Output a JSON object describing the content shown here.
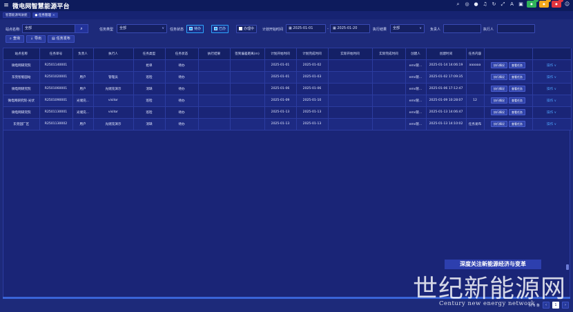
{
  "app": {
    "title": "微电网智慧能源平台"
  },
  "tabs": [
    {
      "label": "智慧能源驾驶舱"
    },
    {
      "label": "任务管理",
      "close": "×"
    }
  ],
  "filters": {
    "site_label": "站点名称:",
    "site_value": "全部",
    "task_type_label": "任务类型",
    "task_type_value": "全部",
    "task_status_label": "任务状态",
    "status_pending": "待办",
    "status_done": "已办",
    "status_doing": "办理中",
    "plan_start_label": "计划开始时间",
    "date_from": "2025-01-01",
    "date_sep": "-",
    "date_to": "2025-01-20",
    "exec_result_label": "执行结果",
    "exec_result_value": "全部",
    "owner_label": "负责人",
    "executor_label": "执行人"
  },
  "actions": {
    "query": "查询",
    "export": "导出",
    "publish": "任务发布"
  },
  "table": {
    "headers": [
      "站点名称",
      "任务单号",
      "负责人",
      "执行人",
      "任务类型",
      "任务状态",
      "执行结果",
      "签到偏差距离(m)",
      "计划开始时间",
      "计划完成时间",
      "实际开始时间",
      "实际完成时间",
      "创建人",
      "创建时间",
      "任务内容",
      "",
      ""
    ],
    "rows": [
      {
        "site": "微电网研究院",
        "no": "R2501140001",
        "owner": "",
        "executor": "",
        "type": "抢单",
        "status": "待办",
        "result": "",
        "dist": "",
        "plan_start": "2025-01-01",
        "plan_end": "2025-01-02",
        "act_start": "",
        "act_end": "",
        "creator": "ems管...",
        "created": "2025-01-14 14:06:19",
        "content": "aaaaaa",
        "b1": "执行情况",
        "b2": "查看任务",
        "op": "操作 ∨"
      },
      {
        "site": "东莞智能园站",
        "no": "R2501020001",
        "owner": "用户",
        "executor": "管理员",
        "type": "巡检",
        "status": "待办",
        "result": "",
        "dist": "",
        "plan_start": "2025-01-01",
        "plan_end": "2025-01-03",
        "act_start": "",
        "act_end": "",
        "creator": "ems管...",
        "created": "2025-01-02 17:09:35",
        "content": "",
        "b1": "执行情况",
        "b2": "查看任务",
        "op": "操作 ∨"
      },
      {
        "site": "微电网研究院",
        "no": "R2501060001",
        "owner": "用户",
        "executor": "光储充演示",
        "type": "消缺",
        "status": "待办",
        "result": "",
        "dist": "",
        "plan_start": "2025-01-06",
        "plan_end": "2025-01-06",
        "act_start": "",
        "act_end": "",
        "creator": "ems管...",
        "created": "2025-01-06 17:12:47",
        "content": "",
        "b1": "执行情况",
        "b2": "查看任务",
        "op": "操作 ∨"
      },
      {
        "site": "微电网研究院-光伏",
        "no": "R2501090001",
        "owner": "光储充...",
        "executor": "visitor",
        "type": "巡检",
        "status": "待办",
        "result": "",
        "dist": "",
        "plan_start": "2025-01-09",
        "plan_end": "2025-01-10",
        "act_start": "",
        "act_end": "",
        "creator": "ems管...",
        "created": "2025-01-09 10:28:07",
        "content": "12",
        "b1": "执行情况",
        "b2": "查看任务",
        "op": "操作 ∨"
      },
      {
        "site": "微电网研究院",
        "no": "R2501130001",
        "owner": "光储充...",
        "executor": "visitor",
        "type": "巡检",
        "status": "待办",
        "result": "",
        "dist": "",
        "plan_start": "2025-01-13",
        "plan_end": "2025-01-13",
        "act_start": "",
        "act_end": "",
        "creator": "ems管...",
        "created": "2025-01-13 14:06:47",
        "content": "",
        "b1": "执行情况",
        "b2": "查看任务",
        "op": "操作 ∨"
      },
      {
        "site": "东莞园厂区",
        "no": "R2501130002",
        "owner": "用户",
        "executor": "光储充演示",
        "type": "消缺",
        "status": "待办",
        "result": "",
        "dist": "",
        "plan_start": "2025-01-13",
        "plan_end": "2025-01-13",
        "act_start": "",
        "act_end": "",
        "creator": "ems管...",
        "created": "2025-01-13 14:10:02",
        "content": "任务发布",
        "b1": "执行情况",
        "b2": "查看任务",
        "op": "操作 ∨"
      }
    ]
  },
  "pager": {
    "prev": "‹",
    "page": "1",
    "next": "›",
    "total_label": "共 6 条"
  },
  "watermark": {
    "banner": "深度关注新能源经济与变革",
    "big": "世纪新能源网",
    "en": "Century new energy network"
  },
  "colors": {
    "accent": "#2da7ff",
    "bg": "#1d2a7a",
    "topbar": "#0d1b5c"
  }
}
